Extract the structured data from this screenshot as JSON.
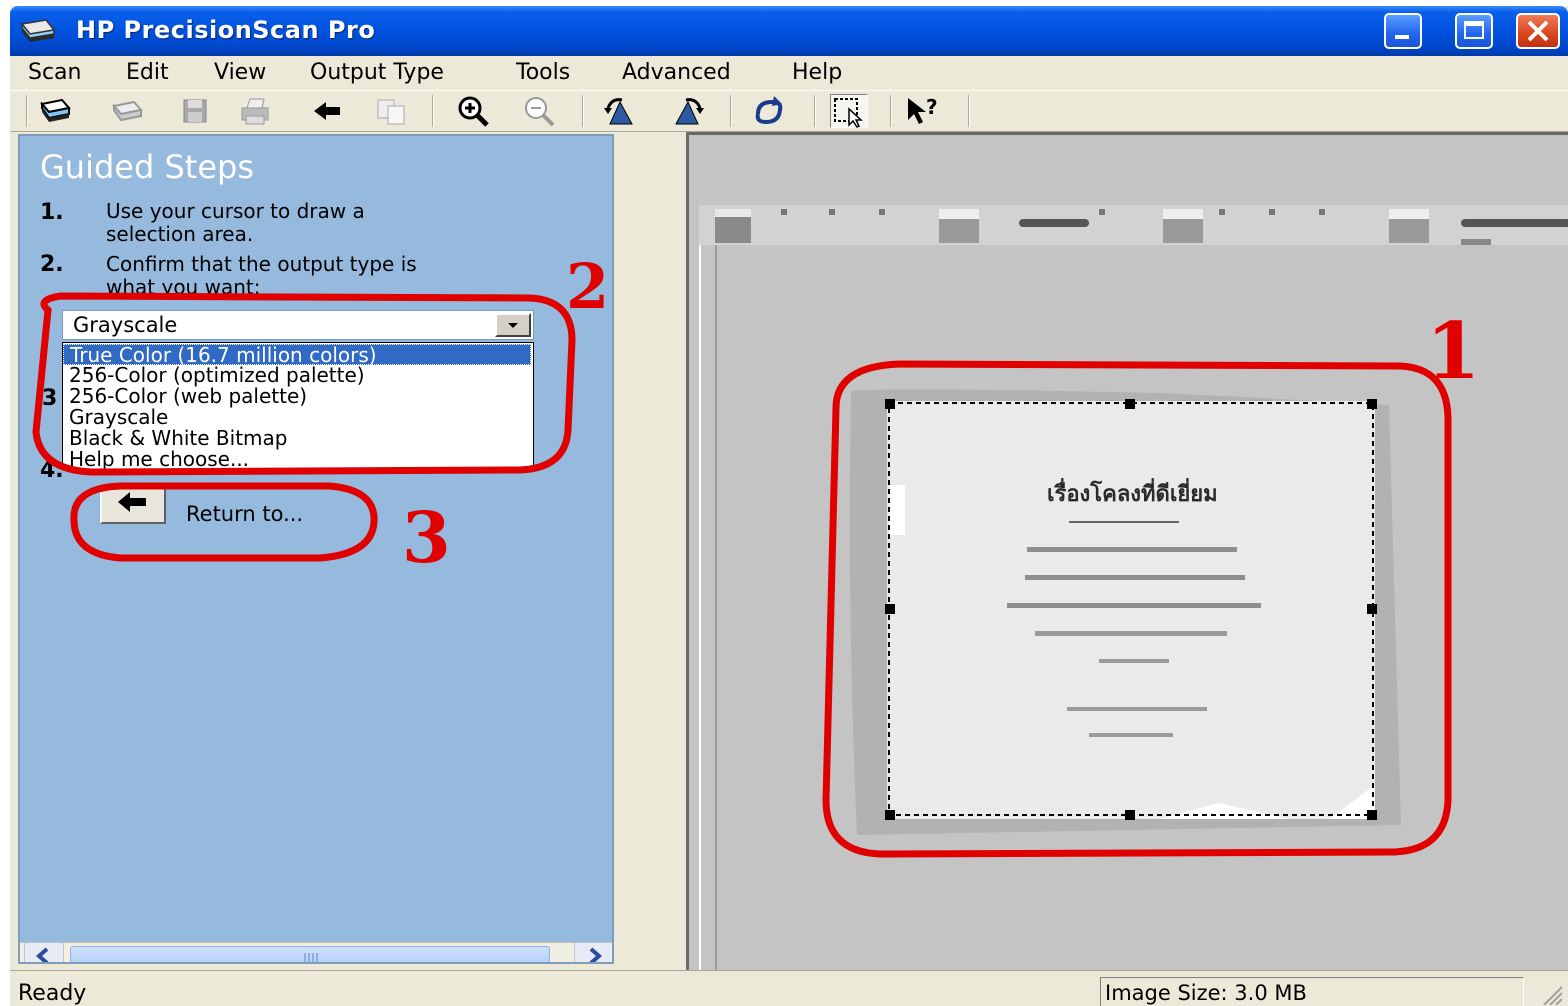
{
  "window": {
    "title": "HP PrecisionScan Pro"
  },
  "menu": [
    "Scan",
    "Edit",
    "View",
    "Output Type",
    "Tools",
    "Advanced",
    "Help"
  ],
  "toolbar": {
    "icons": [
      "scan-icon",
      "rescan-icon",
      "save-icon",
      "print-icon",
      "back-arrow-icon",
      "copy-icon",
      "zoom-in-icon",
      "zoom-out-icon",
      "rotate-left-icon",
      "rotate-right-icon",
      "reset-icon",
      "select-area-icon",
      "whats-this-help-icon"
    ]
  },
  "guided_steps": {
    "title": "Guided Steps",
    "steps": [
      {
        "num": "1.",
        "text_line1": "Use your cursor to draw a",
        "text_line2": "selection area."
      },
      {
        "num": "2.",
        "text_line1": "Confirm that the output type is",
        "text_line2": "what you want:"
      },
      {
        "num": "3",
        "text": ""
      },
      {
        "num": "4.",
        "text": ""
      }
    ],
    "output_type_select": {
      "value": "Grayscale",
      "options": [
        "True Color (16.7 million colors)",
        "256-Color (optimized palette)",
        "256-Color (web palette)",
        "Grayscale",
        "Black & White Bitmap",
        "Help me choose..."
      ],
      "highlighted_index": 0
    },
    "return_button": {
      "label": "Return to..."
    }
  },
  "preview": {
    "document_text": {
      "heading": "เรื่องโคลงที่ดีเยี่ยม"
    }
  },
  "annotations": [
    "1",
    "2",
    "3"
  ],
  "annotation_color": "#e00000",
  "statusbar": {
    "left": "Ready",
    "image_size": "Image Size: 3.0 MB"
  },
  "colors": {
    "titlebar": "#0053e0",
    "guided_panel_bg": "#96b9de",
    "selection_highlight": "#316ac5",
    "preview_bg": "#c4c4c4",
    "chrome": "#ece9d8"
  }
}
